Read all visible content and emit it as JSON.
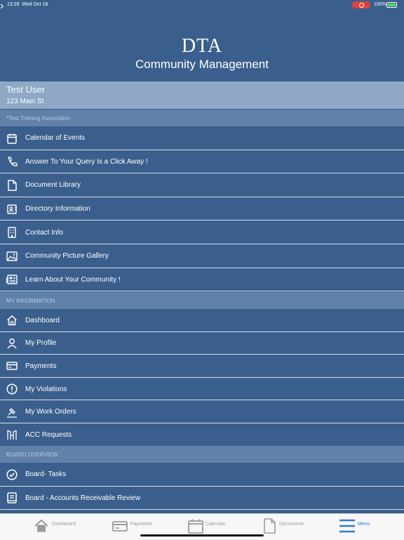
{
  "status": {
    "time": "13:26",
    "date": "Wed Oct 18",
    "battery": "100%"
  },
  "header": {
    "logo": "DTA",
    "subtitle": "Community Management"
  },
  "user": {
    "name": "Test User",
    "address": "123 Main St"
  },
  "sections": {
    "association": "*Test Training Association",
    "my_information": "MY INFORMATION",
    "board_overview": "BOARD OVERVIEW"
  },
  "community_items": [
    {
      "label": "Calendar of Events",
      "icon": "calendar-icon"
    },
    {
      "label": "Answer To Your Query Is a Click Away !",
      "icon": "phone-icon"
    },
    {
      "label": "Document Library",
      "icon": "document-icon"
    },
    {
      "label": "Directory Information",
      "icon": "contact-card-icon"
    },
    {
      "label": "Contact Info",
      "icon": "building-icon"
    },
    {
      "label": "Community Picture Gallery",
      "icon": "image-icon"
    },
    {
      "label": "Learn About Your Community !",
      "icon": "newspaper-icon"
    }
  ],
  "my_items": [
    {
      "label": "Dashboard",
      "icon": "home-icon"
    },
    {
      "label": "My Profile",
      "icon": "person-icon"
    },
    {
      "label": "Payments",
      "icon": "credit-card-icon"
    },
    {
      "label": "My Violations",
      "icon": "alert-icon"
    },
    {
      "label": "My Work Orders",
      "icon": "hammer-icon"
    },
    {
      "label": "ACC Requests",
      "icon": "acc-icon"
    }
  ],
  "board_items": [
    {
      "label": "Board- Tasks",
      "icon": "check-circle-icon"
    },
    {
      "label": "Board - Accounts Receivable Review",
      "icon": "book-icon"
    }
  ],
  "tabs": [
    {
      "label": "Dashboard",
      "icon": "home-icon",
      "active": false
    },
    {
      "label": "Payments",
      "icon": "credit-card-icon",
      "active": false
    },
    {
      "label": "Calendar",
      "icon": "calendar-icon",
      "active": false
    },
    {
      "label": "Documents",
      "icon": "document-icon",
      "active": false
    },
    {
      "label": "Menu",
      "icon": "menu-icon",
      "active": true
    }
  ],
  "colors": {
    "background": "#3a5f8c",
    "user_band": "#8ea8c6",
    "section": "#5f81aa",
    "tab_active": "#2f7ad6"
  }
}
